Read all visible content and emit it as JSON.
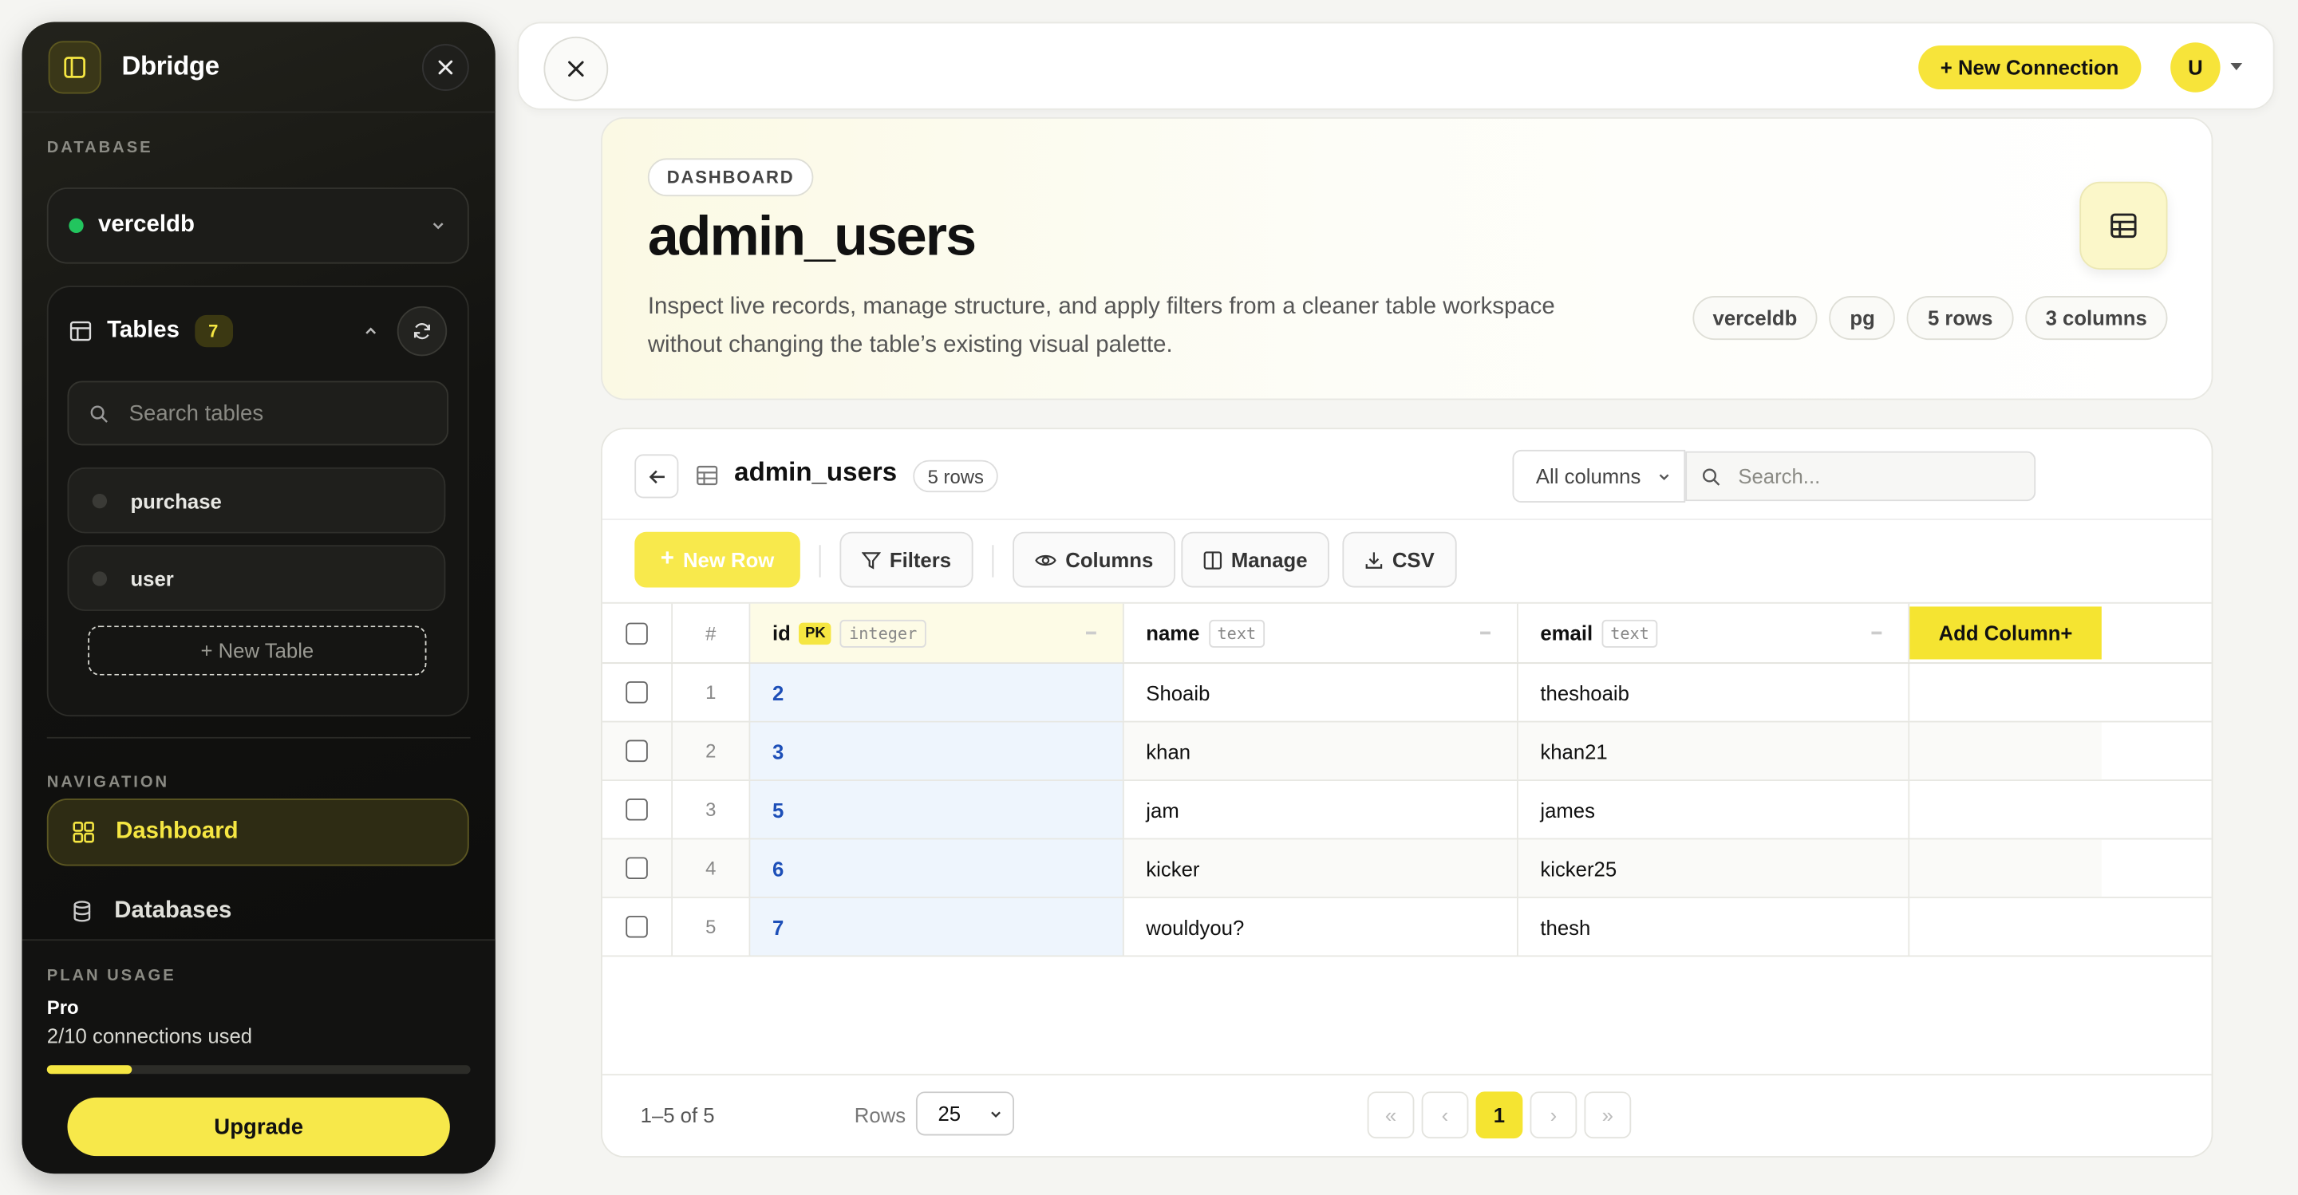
{
  "sidebar": {
    "brand": "Dbridge",
    "database_label": "DATABASE",
    "database_name": "verceldb",
    "tables_title": "Tables",
    "tables_count": "7",
    "search_placeholder": "Search tables",
    "tables": [
      {
        "label": "purchase"
      },
      {
        "label": "user"
      }
    ],
    "new_table": "+  New Table",
    "navigation_label": "NAVIGATION",
    "nav": [
      {
        "label": "Dashboard",
        "active": true
      },
      {
        "label": "Databases",
        "active": false
      }
    ],
    "plan_label": "PLAN USAGE",
    "plan_name": "Pro",
    "plan_usage": "2/10 connections used",
    "plan_fraction": 0.2,
    "upgrade": "Upgrade"
  },
  "topbar": {
    "new_connection": "+ New Connection",
    "avatar_initial": "U"
  },
  "hero": {
    "badge": "DASHBOARD",
    "title": "admin_users",
    "description": "Inspect live records, manage structure, and apply filters from a cleaner table workspace without changing the table’s existing visual palette.",
    "chips": [
      "verceldb",
      "pg",
      "5 rows",
      "3 columns"
    ]
  },
  "table": {
    "title": "admin_users",
    "rows_badge": "5 rows",
    "column_filter": "All columns",
    "search_placeholder": "Search...",
    "toolbar": {
      "new_row": "New Row",
      "filters": "Filters",
      "columns": "Columns",
      "manage": "Manage",
      "csv": "CSV"
    },
    "headers": {
      "index": "#",
      "id": "id",
      "id_pk": "PK",
      "id_type": "integer",
      "name": "name",
      "name_type": "text",
      "email": "email",
      "email_type": "text",
      "add_column": "Add Column+"
    },
    "rows": [
      {
        "n": "1",
        "id": "2",
        "name": "Shoaib",
        "email": "theshoaib"
      },
      {
        "n": "2",
        "id": "3",
        "name": "khan",
        "email": "khan21"
      },
      {
        "n": "3",
        "id": "5",
        "name": "jam",
        "email": "james"
      },
      {
        "n": "4",
        "id": "6",
        "name": "kicker",
        "email": "kicker25"
      },
      {
        "n": "5",
        "id": "7",
        "name": "wouldyou?",
        "email": "thesh"
      }
    ],
    "footer": {
      "count": "1–5 of 5",
      "rows_label": "Rows",
      "rows_per_page": "25",
      "first": "«",
      "prev": "‹",
      "page": "1",
      "next": "›",
      "last": "»"
    }
  }
}
